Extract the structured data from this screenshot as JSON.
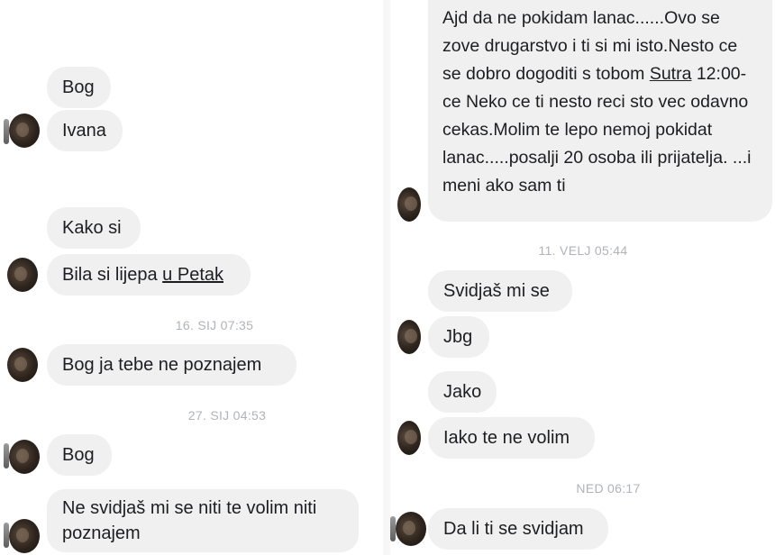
{
  "left": {
    "messages": [
      {
        "text": "Bog"
      },
      {
        "text": "Ivana"
      },
      {
        "text": "Kako si"
      },
      {
        "pre": "Bila si lijepa ",
        "link": "u Petak"
      },
      {
        "text": "Bog ja tebe ne poznajem"
      },
      {
        "text": "Bog"
      },
      {
        "text": "Ne svidjaš mi se niti te volim niti poznajem"
      }
    ],
    "timestamps": [
      "16. SIJ 07:35",
      "27. SIJ 04:53"
    ]
  },
  "right": {
    "chain_message": {
      "pre": "Ajd da ne pokidam lanac......Ovo se zove drugarstvo i ti si mi isto.Nesto ce se dobro dogoditi s tobom ",
      "link": "Sutra",
      "post": " 12:00-ce Neko ce ti nesto reci sto vec odavno cekas.Molim te lepo nemoj pokidat lanac.....posalji 20 osoba ili prijatelja. ...i meni ako sam ti"
    },
    "messages": [
      {
        "text": "Svidjaš mi se"
      },
      {
        "text": "Jbg"
      },
      {
        "text": "Jako"
      },
      {
        "text": "Iako te ne volim"
      },
      {
        "text": "Da li ti se svidjam"
      }
    ],
    "timestamps": [
      "11. VELJ 05:44",
      "NED 06:17"
    ]
  },
  "colors": {
    "bubble": "#f0f0f0",
    "timestamp": "#b0b3b8",
    "text": "#1c1e21"
  }
}
